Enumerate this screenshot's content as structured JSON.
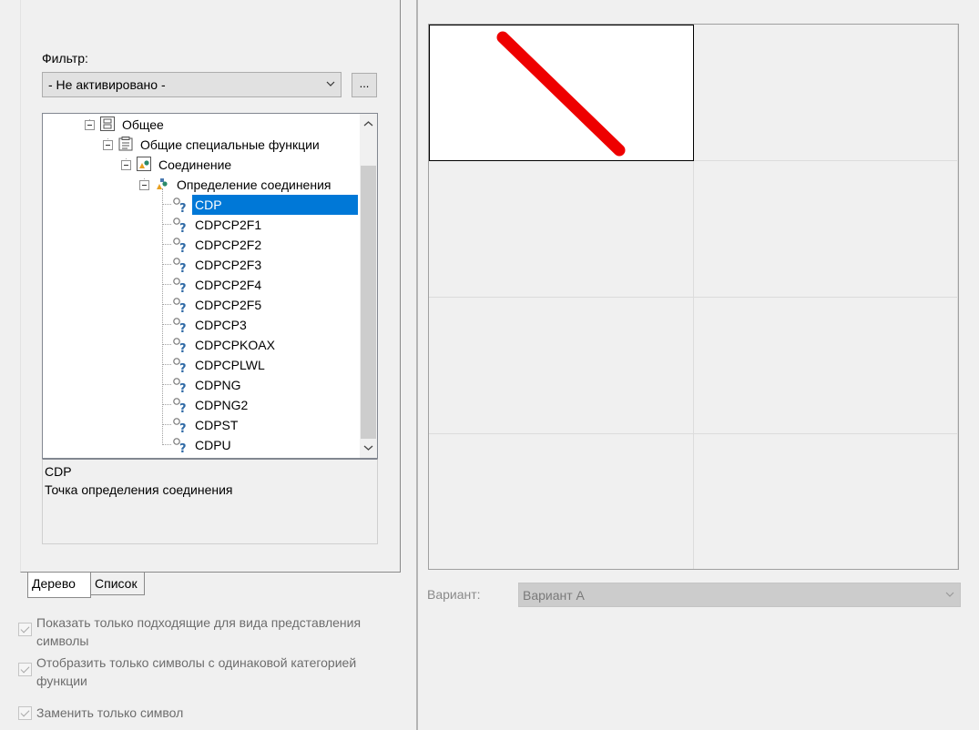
{
  "filter": {
    "label": "Фильтр:",
    "selected": "- Не активировано -",
    "browse_label": "..."
  },
  "tree": {
    "groups": [
      {
        "label": "Общее",
        "icon": "group-icon"
      },
      {
        "label": "Общие специальные функции",
        "icon": "special-functions-icon"
      },
      {
        "label": "Соединение",
        "icon": "connection-icon"
      },
      {
        "label": "Определение соединения",
        "icon": "connection-definition-icon"
      }
    ],
    "symbols": [
      "CDP",
      "CDPCP2F1",
      "CDPCP2F2",
      "CDPCP2F3",
      "CDPCP2F4",
      "CDPCP2F5",
      "CDPCP3",
      "CDPCPKOAX",
      "CDPCPLWL",
      "CDPNG",
      "CDPNG2",
      "CDPST",
      "CDPU"
    ],
    "selected_index": 0
  },
  "description": {
    "name": "CDP",
    "text": "Точка определения соединения"
  },
  "tabs": {
    "tree": "Дерево",
    "list": "Список"
  },
  "options": [
    {
      "label": "Показать только подходящие для вида представления символы",
      "checked": true
    },
    {
      "label": "Отобразить только символы с одинаковой категорией функции",
      "checked": true
    },
    {
      "label": "Заменить только символ",
      "checked": true
    }
  ],
  "variant": {
    "label": "Вариант:",
    "selected": "Вариант A"
  },
  "colors": {
    "selection": "#0078d7",
    "symbol_stroke": "#ee0000"
  }
}
